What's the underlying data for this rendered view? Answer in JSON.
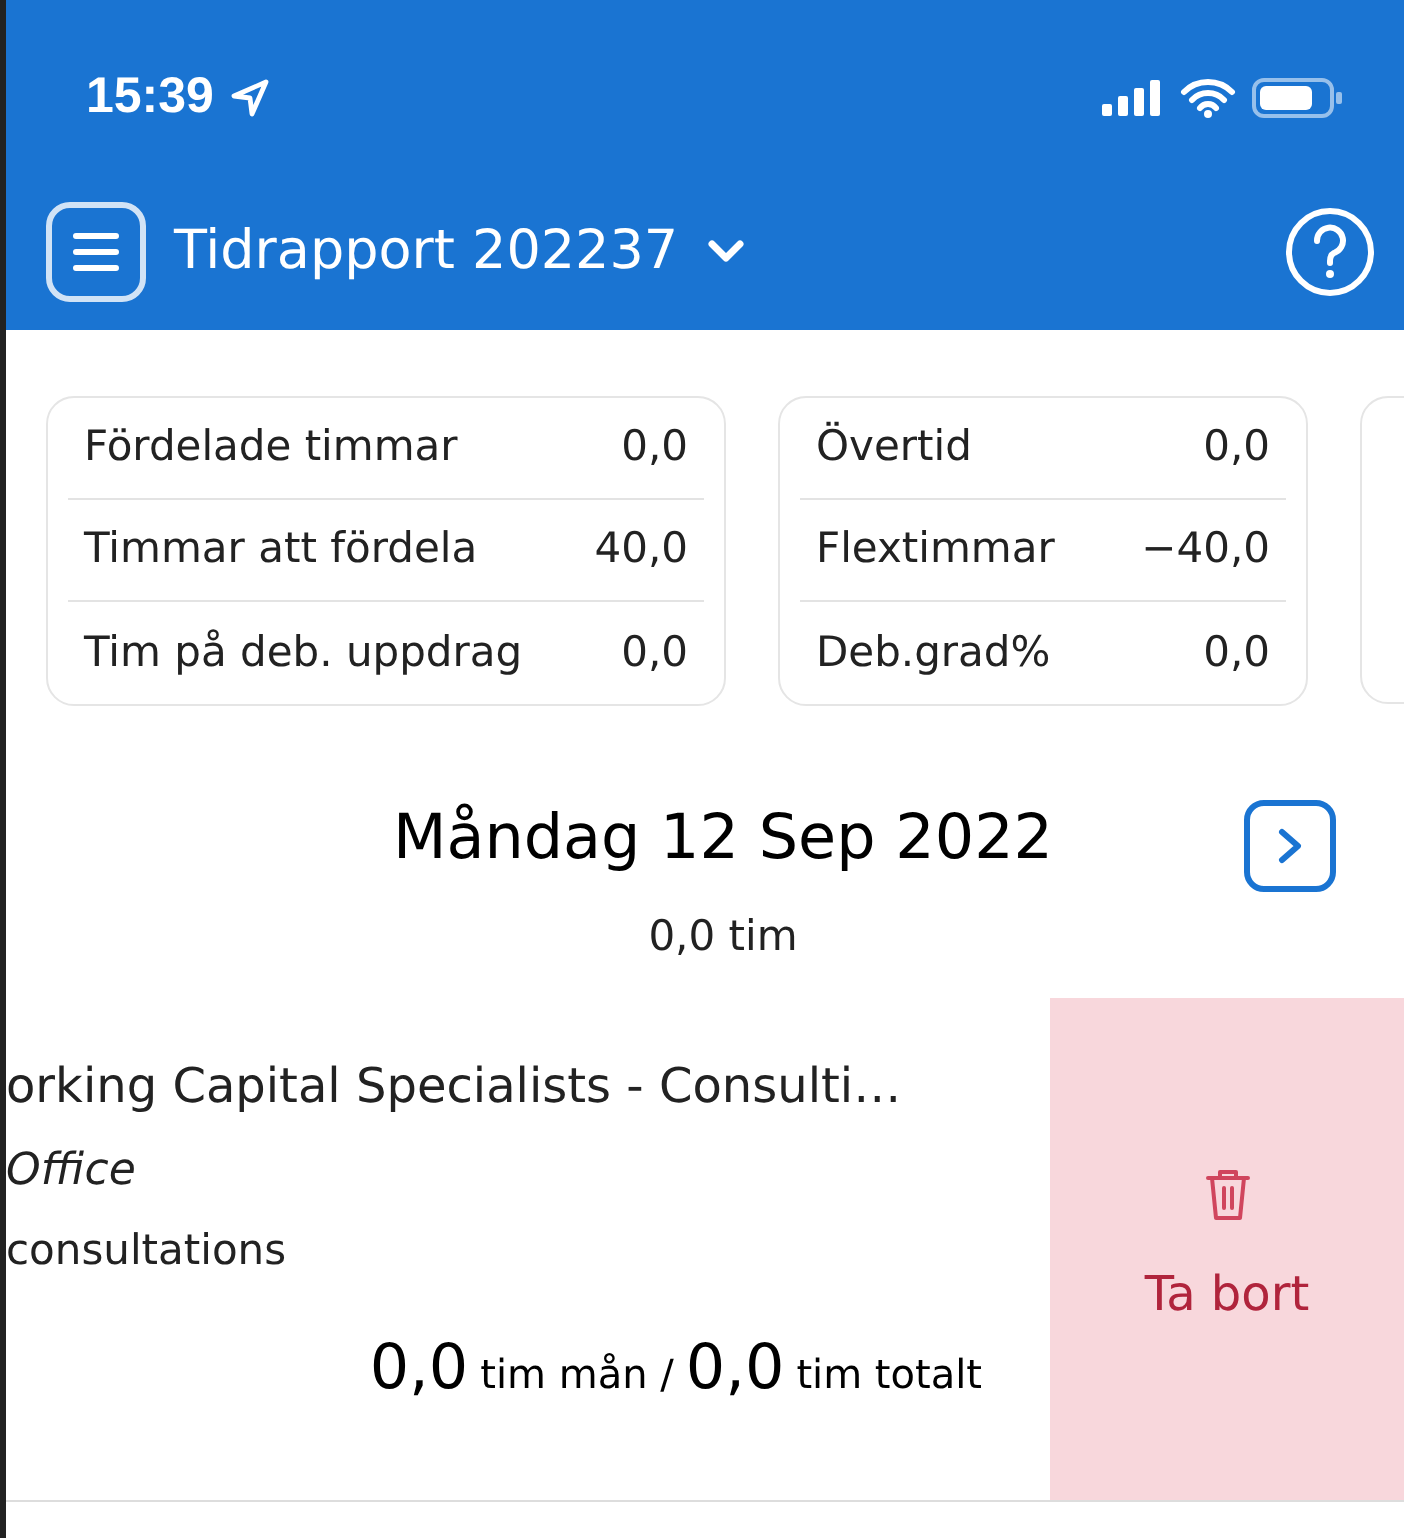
{
  "status_bar": {
    "time": "15:39"
  },
  "header": {
    "title": "Tidrapport 202237"
  },
  "summary_cards": [
    {
      "rows": [
        {
          "label": "Fördelade timmar",
          "value": "0,0"
        },
        {
          "label": "Timmar att fördela",
          "value": "40,0"
        },
        {
          "label": "Tim på deb. uppdrag",
          "value": "0,0"
        }
      ]
    },
    {
      "rows": [
        {
          "label": "Övertid",
          "value": "0,0"
        },
        {
          "label": "Flextimmar",
          "value": "−40,0"
        },
        {
          "label": "Deb.grad%",
          "value": "0,0"
        }
      ]
    }
  ],
  "day": {
    "date": "Måndag 12 Sep 2022",
    "total": "0,0 tim"
  },
  "entry": {
    "project": "orking Capital Specialists - Consulti…",
    "location": "Office",
    "activity": "consultations",
    "month_hours": "0,0",
    "month_unit": "tim mån /",
    "total_hours": "0,0",
    "total_unit": "tim totalt"
  },
  "delete_action": {
    "label": "Ta bort"
  }
}
